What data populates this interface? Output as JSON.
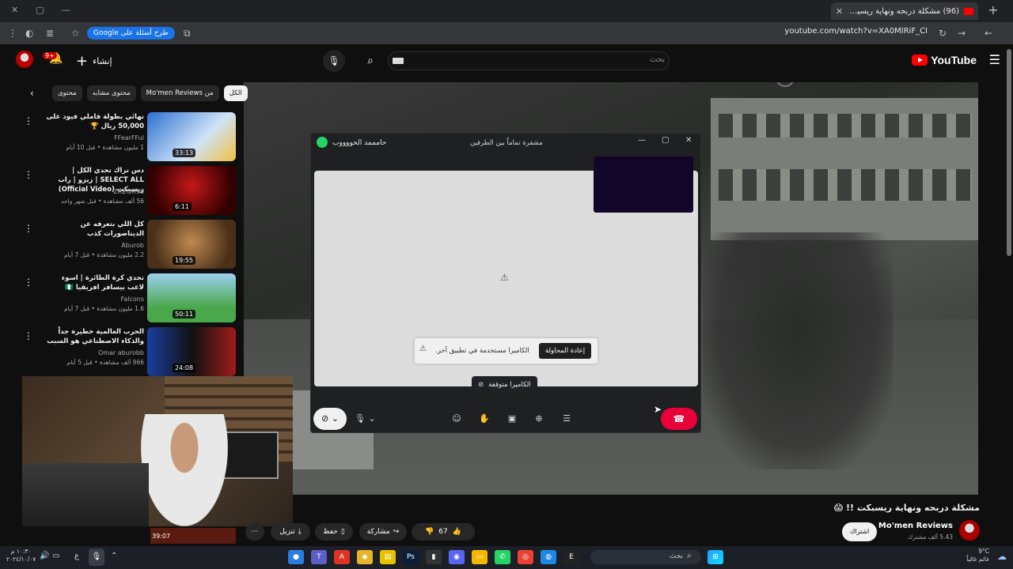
{
  "browser": {
    "tab_title": "(96) مشكلة دربحه ونهاية ريسيكت",
    "url": "youtube.com/watch?v=XA0MlRiF_CI",
    "google_chip": "طرح أسئلة على Google"
  },
  "masthead": {
    "logo_text": "YouTube",
    "search_placeholder": "بحث",
    "create_label": "إنشاء",
    "notif_badge": "9+"
  },
  "chips": [
    "الكل",
    "من Mo'men Reviews",
    "محتوى مشابه",
    "محتوى"
  ],
  "recommendations": [
    {
      "title": "نهائي بطولة فاملي فيود على 50,000 ريال 🏆",
      "channel": "FFearFFul",
      "meta": "1 مليون مشاهدة • قبل 10 أيام",
      "duration": "33:13"
    },
    {
      "title": "دس تراك تحدي الكل | SELECT ALL | زيزو | راب ريسبكت (Official Video)",
      "channel": "ZRZOR96",
      "meta": "56 ألف مشاهدة • قبل شهر واحد",
      "duration": "6:11"
    },
    {
      "title": "كل اللي بتعرفه عن الديناصورات كذب",
      "channel": "Aburob",
      "meta": "2.2 مليون مشاهدة • قبل 7 أيام",
      "duration": "19:55"
    },
    {
      "title": "تحدي كرة الطائرة | اسوء لاعب بيسافر افريقيا 🇳🇬",
      "channel": "Falcons",
      "meta": "1.6 مليون مشاهدة • قبل 7 أيام",
      "duration": "50:11"
    },
    {
      "title": "الحرب العالمية خطيرة جداً والذكاء الاصطناعي هو السبب",
      "channel": "Omar aburobb",
      "meta": "966 ألف مشاهدة • قبل 5 أيام",
      "duration": "24:08"
    }
  ],
  "whatsapp_call": {
    "contact_name": "حامممد الحووووب",
    "encryption": "مشفرة تماماً بين الطرفين",
    "toast_text": "الكاميرا مستخدمة في تطبيق آخر.",
    "retry_label": "إعادة المحاولة",
    "camera_stopped": "الكاميرا متوقفة"
  },
  "video": {
    "title": "مشكلة دربحه ونهاية ريسبكت !! 😱",
    "channel_name": "Mo'men Reviews",
    "subscribers": "5.43 ألف مشترك",
    "subscribe_label": "اشتراك",
    "likes": "67",
    "share_label": "مشاركة",
    "save_label": "حفظ",
    "download_label": "تنزيل",
    "side_duration": "39:07"
  },
  "taskbar": {
    "search_label": "بحث",
    "clock_time": "١٠:٣٠ م",
    "clock_date": "٢٠٢٤/١٠/٠٧",
    "lang": "ع",
    "weather_temp": "9°C",
    "weather_desc": "غائم غالباً"
  }
}
